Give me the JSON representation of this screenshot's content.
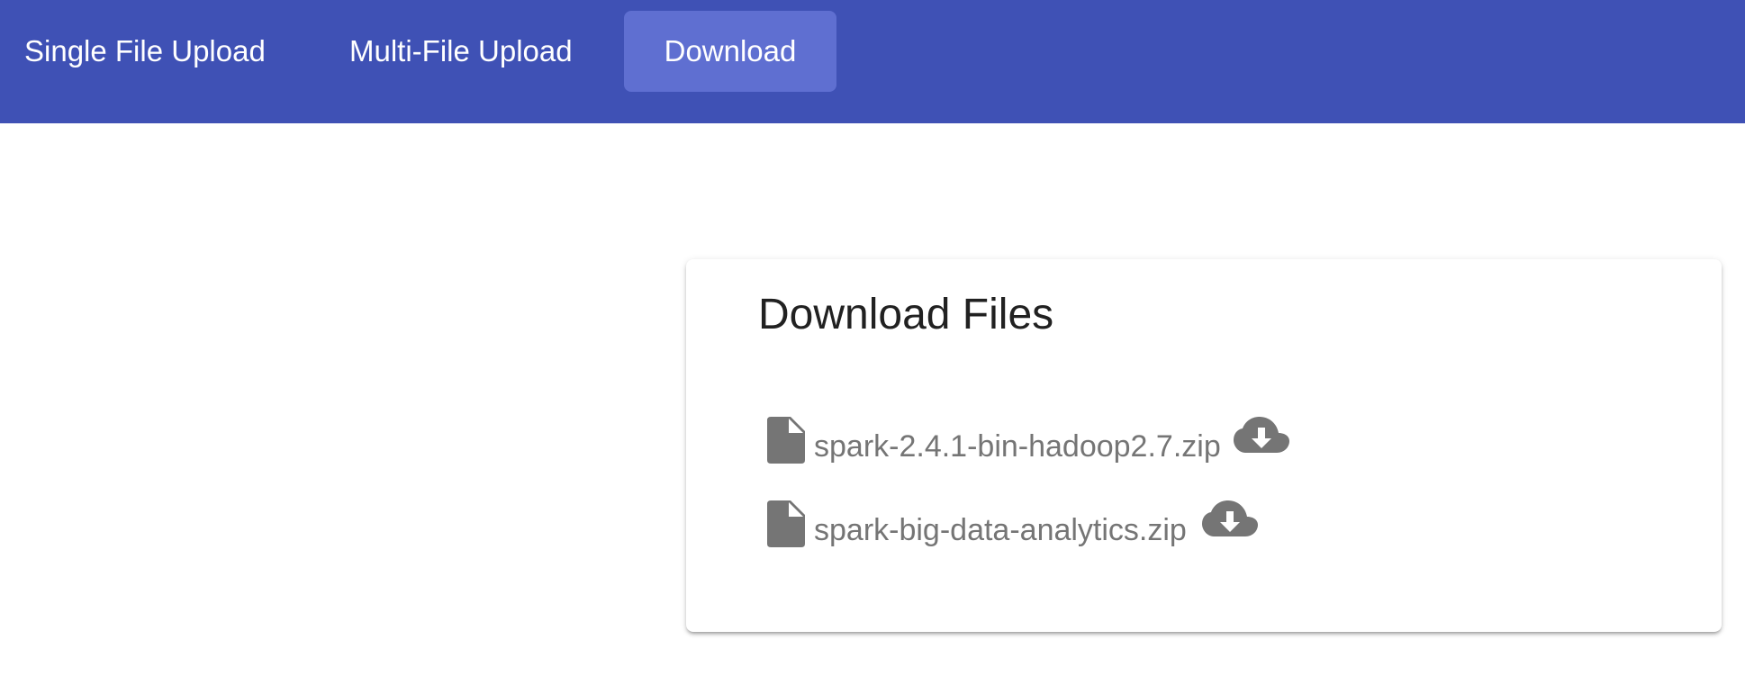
{
  "nav": {
    "tabs": [
      {
        "label": "Single File Upload",
        "active": false
      },
      {
        "label": "Multi-File Upload",
        "active": false
      },
      {
        "label": "Download",
        "active": true
      }
    ]
  },
  "card": {
    "title": "Download Files",
    "files": [
      {
        "name": "spark-2.4.1-bin-hadoop2.7.zip",
        "icon": "file-icon",
        "action_icon": "cloud-download-icon"
      },
      {
        "name": "spark-big-data-analytics.zip",
        "icon": "file-icon",
        "action_icon": "cloud-download-icon"
      }
    ]
  },
  "colors": {
    "primary": "#3f51b5",
    "active_tab": "#5f6fd1",
    "icon_gray": "#757575"
  }
}
